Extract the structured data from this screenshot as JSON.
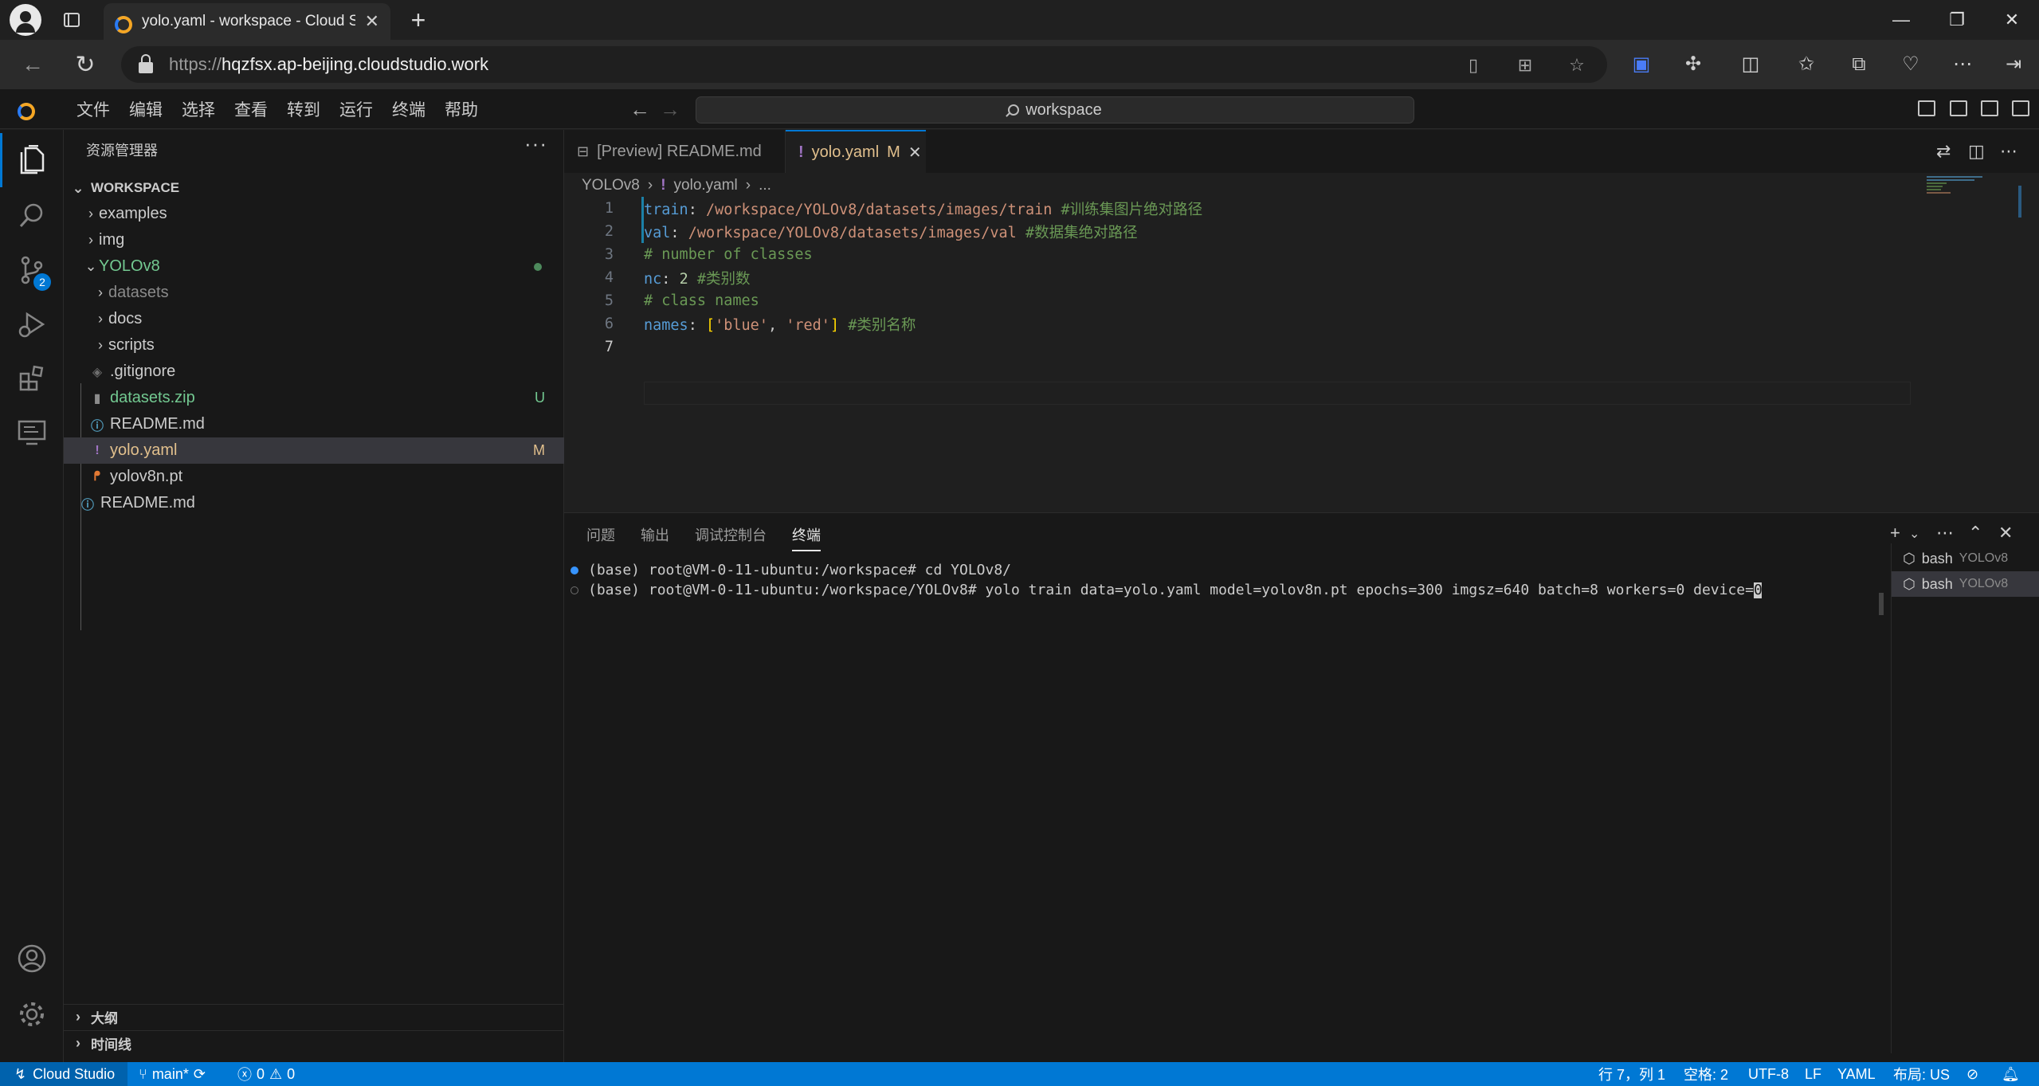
{
  "browser": {
    "tab_title": "yolo.yaml - workspace - Cloud Studio",
    "new_tab": "+",
    "url_prefix": "https://",
    "url_host": "hqzfsx.ap-beijing.cloudstudio.work",
    "window_controls": {
      "minimize": "—",
      "restore": "❐",
      "close": "✕"
    }
  },
  "menu": [
    "文件",
    "编辑",
    "选择",
    "查看",
    "转到",
    "运行",
    "终端",
    "帮助"
  ],
  "command_center": "workspace",
  "scm_badge": "2",
  "sidebar": {
    "title": "资源管理器",
    "workspace_label": "WORKSPACE",
    "tree": [
      {
        "label": "examples",
        "type": "folder",
        "color": "#cccccc"
      },
      {
        "label": "img",
        "type": "folder",
        "color": "#cccccc"
      },
      {
        "label": "YOLOv8",
        "type": "folder-open",
        "color": "#73c991"
      },
      {
        "label": "datasets",
        "type": "folder",
        "color": "#8b8b8b"
      },
      {
        "label": "docs",
        "type": "folder",
        "color": "#cccccc"
      },
      {
        "label": "scripts",
        "type": "folder",
        "color": "#cccccc"
      },
      {
        "label": ".gitignore",
        "type": "file",
        "color": "#cccccc"
      },
      {
        "label": "datasets.zip",
        "type": "file",
        "color": "#73c991",
        "deco": "U"
      },
      {
        "label": "README.md",
        "type": "file",
        "color": "#cccccc"
      },
      {
        "label": "yolo.yaml",
        "type": "file",
        "color": "#e2c08d",
        "deco": "M"
      },
      {
        "label": "yolov8n.pt",
        "type": "file",
        "color": "#cccccc"
      },
      {
        "label": "README.md",
        "type": "file",
        "color": "#cccccc"
      }
    ],
    "outline": "大纲",
    "timeline": "时间线"
  },
  "editor": {
    "tabs": [
      {
        "label": "[Preview] README.md"
      },
      {
        "label": "yolo.yaml",
        "badge": "M"
      }
    ],
    "breadcrumb": [
      "YOLOv8",
      "yolo.yaml",
      "..."
    ],
    "lines": {
      "l1_key": "train",
      "l1_colon": ":",
      "l1_val": " /workspace/YOLOv8/datasets/images/train ",
      "l1_cmt": "#训练集图片绝对路径",
      "l2_key": "val",
      "l2_colon": ":",
      "l2_val": " /workspace/YOLOv8/datasets/images/val ",
      "l2_cmt": "#数据集绝对路径",
      "l3_cmt": "# number of classes",
      "l4_key": "nc",
      "l4_colon": ": ",
      "l4_num": "2",
      "l4_cmt": " #类别数",
      "l5_cmt": "# class names",
      "l6_key": "names",
      "l6_colon": ": ",
      "l6_open": "[",
      "l6_s1": "'blue'",
      "l6_comma": ", ",
      "l6_s2": "'red'",
      "l6_close": "]",
      "l6_cmt": " #类别名称"
    },
    "line_numbers": [
      "1",
      "2",
      "3",
      "4",
      "5",
      "6",
      "7"
    ]
  },
  "panel": {
    "tabs": [
      "问题",
      "输出",
      "调试控制台",
      "终端"
    ],
    "terminal_lines": [
      "(base) root@VM-0-11-ubuntu:/workspace# cd YOLOv8/",
      "(base) root@VM-0-11-ubuntu:/workspace/YOLOv8# yolo train data=yolo.yaml model=yolov8n.pt epochs=300 imgsz=640 batch=8 workers=0 device="
    ],
    "cursor_char": "0",
    "terminals": [
      {
        "name": "bash",
        "cwd": "YOLOv8"
      },
      {
        "name": "bash",
        "cwd": "YOLOv8"
      }
    ]
  },
  "status": {
    "remote": "Cloud Studio",
    "branch": "main*",
    "errors": "0",
    "warnings": "0",
    "position": "行 7，列 1",
    "spaces": "空格: 2",
    "encoding": "UTF-8",
    "eol": "LF",
    "language": "YAML",
    "layout": "布局: US"
  }
}
